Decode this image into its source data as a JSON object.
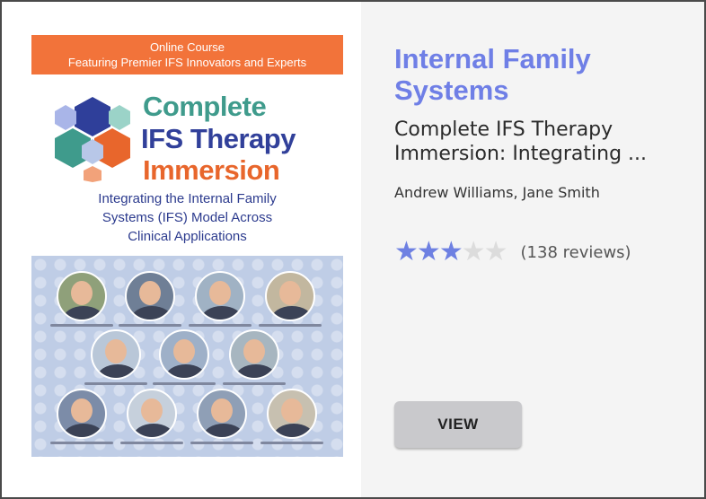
{
  "course": {
    "category": "Internal Family Systems",
    "title": "Complete IFS Therapy Immersion: Integrating ...",
    "authors": "Andrew Williams, Jane Smith",
    "rating": 3,
    "rating_max": 5,
    "reviews": "(138 reviews)",
    "view_label": "VIEW"
  },
  "thumbnail": {
    "banner_line1": "Online Course",
    "banner_line2": "Featuring Premier IFS Innovators and Experts",
    "title_line1": "Complete",
    "title_line2": "IFS Therapy",
    "title_line3": "Immersion",
    "subtitle_line1": "Integrating the Internal Family",
    "subtitle_line2": "Systems (IFS) Model Across",
    "subtitle_line3": "Clinical Applications"
  },
  "colors": {
    "accent": "#6f7fe6",
    "banner": "#f2733a",
    "star_on": "#6e80e2",
    "star_off": "#dcdcdc"
  }
}
